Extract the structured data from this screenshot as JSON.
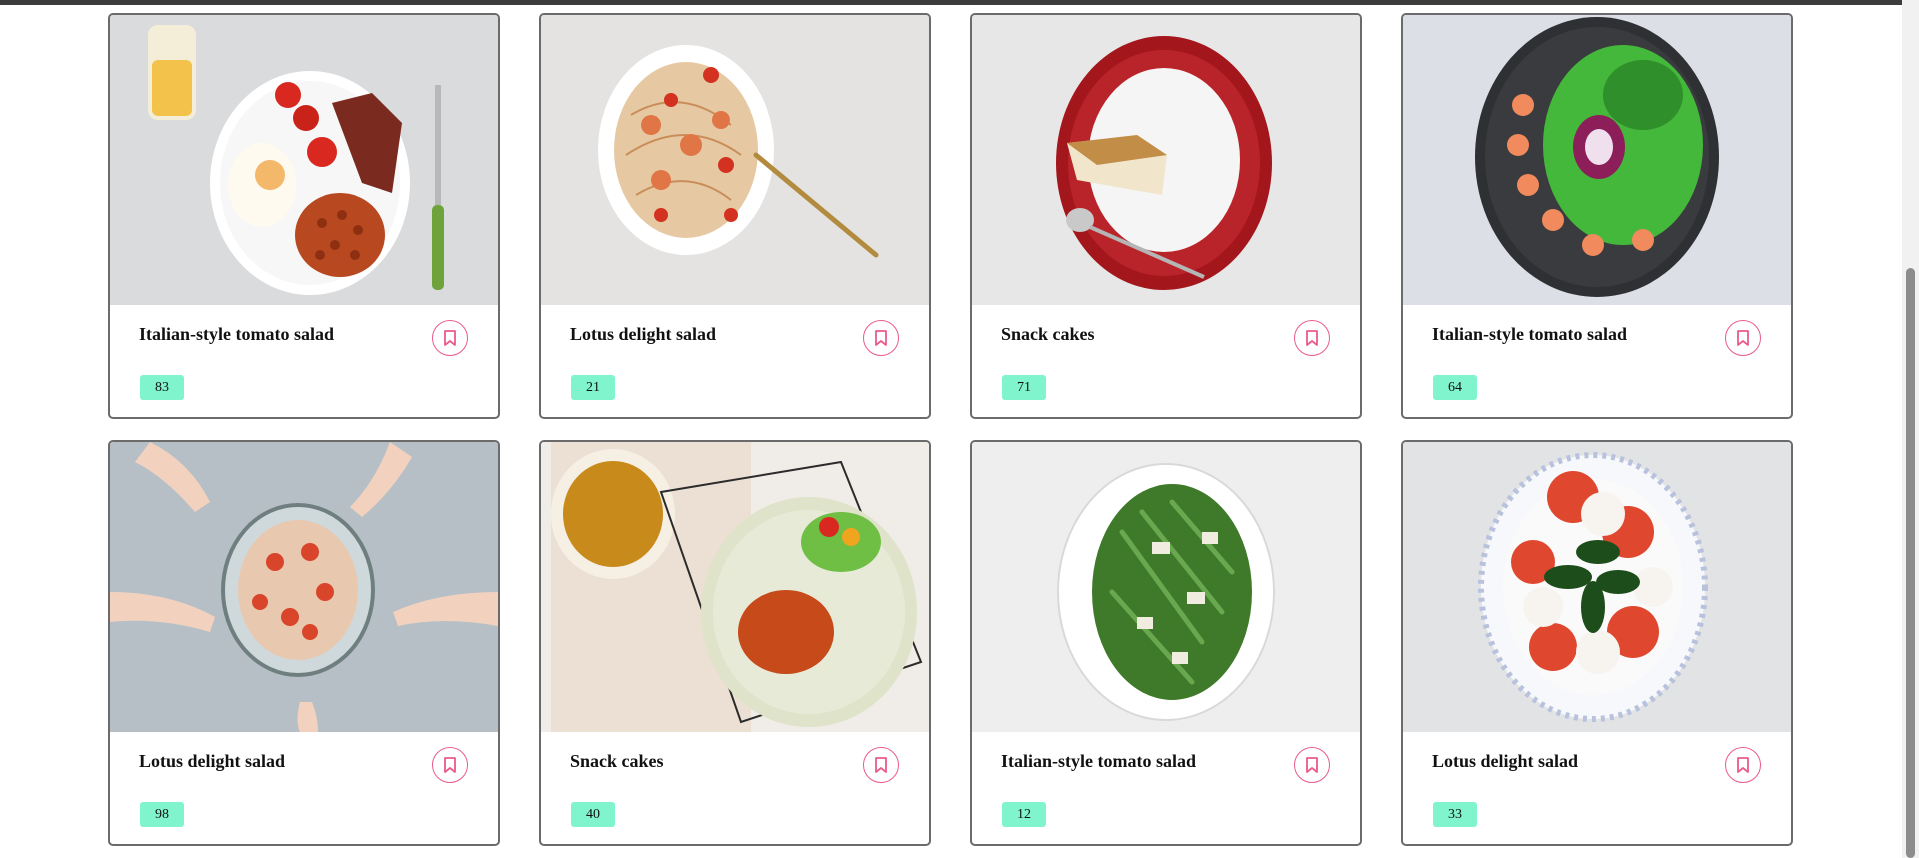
{
  "cards": [
    {
      "title": "Italian-style tomato salad",
      "count": "83",
      "image": "breakfast-plate"
    },
    {
      "title": "Lotus delight salad",
      "count": "21",
      "image": "shrimp-spaghetti"
    },
    {
      "title": "Snack cakes",
      "count": "71",
      "image": "cake-slice"
    },
    {
      "title": "Italian-style tomato salad",
      "count": "64",
      "image": "shrimp-green-salad"
    },
    {
      "title": "Lotus delight salad",
      "count": "98",
      "image": "shared-shrimp-bowl"
    },
    {
      "title": "Snack cakes",
      "count": "40",
      "image": "lasagna-and-soup"
    },
    {
      "title": "Italian-style tomato salad",
      "count": "12",
      "image": "asparagus-plate"
    },
    {
      "title": "Lotus delight salad",
      "count": "33",
      "image": "caprese-plate"
    }
  ],
  "icons": {
    "bookmark": "bookmark-icon"
  },
  "colors": {
    "bookmark_accent": "#ea5b8a",
    "count_badge": "#7ff4cd",
    "card_border": "#6b6b6b"
  }
}
